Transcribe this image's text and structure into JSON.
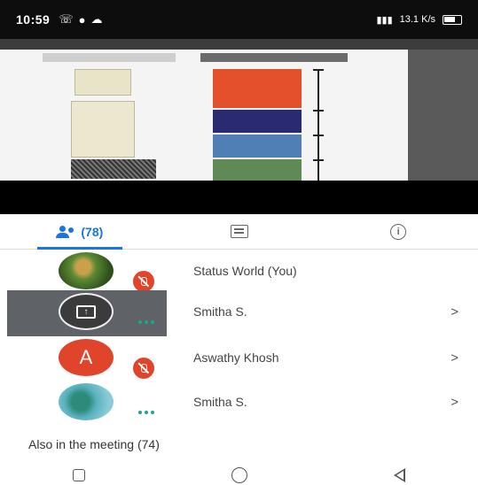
{
  "status_bar": {
    "time": "10:59",
    "right_text": "4G",
    "speed": "13.1 K/s"
  },
  "tabs": [
    {
      "icon": "people-icon",
      "label": "(78)",
      "active": true
    },
    {
      "icon": "chat-icon",
      "label": "",
      "active": false
    },
    {
      "icon": "info-icon",
      "label": "",
      "active": false
    }
  ],
  "participants": [
    {
      "name": "Status World (You)",
      "avatar": "image",
      "avatar_text": "",
      "status": "muted",
      "chevron": ""
    },
    {
      "name": "Smitha S.",
      "avatar": "presenting",
      "avatar_text": "",
      "status": "speaking",
      "chevron": ">"
    },
    {
      "name": "Aswathy Khosh",
      "avatar": "letter",
      "avatar_text": "A",
      "status": "muted",
      "chevron": ">"
    },
    {
      "name": "Smitha S.",
      "avatar": "image",
      "avatar_text": "",
      "status": "speaking",
      "chevron": ">"
    }
  ],
  "also_in_meeting": "Also in the meeting (74)",
  "colors": {
    "accent": "#1a73e8",
    "mute_red": "#e0452c",
    "speaking_teal": "#1ea58a"
  }
}
